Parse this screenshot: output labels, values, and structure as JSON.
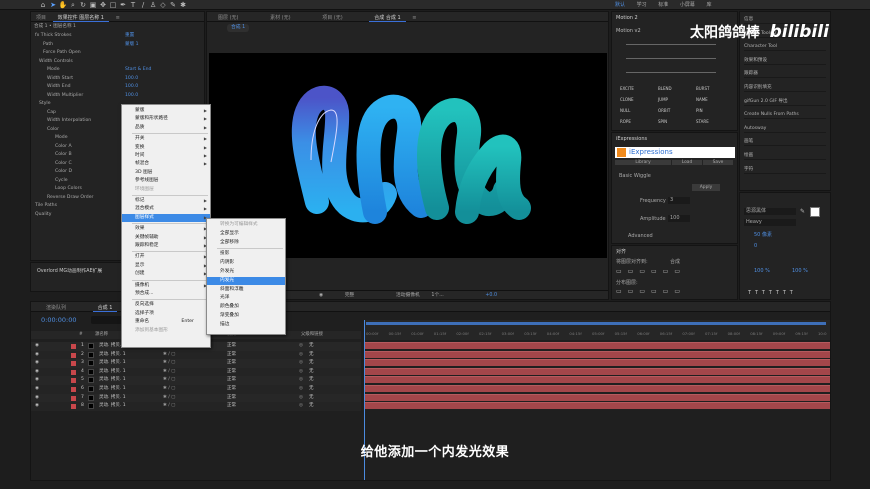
{
  "toolbar": {
    "workspace_tabs": [
      "默认",
      "学习",
      "标准",
      "小屏幕",
      "库"
    ]
  },
  "watermark": {
    "channel": "太阳鸽鸽棒",
    "site": "bilibili"
  },
  "effect_controls": {
    "tabs": [
      "项目",
      "效果控件 图层名称 1",
      "≡"
    ],
    "header": "合成 1 • 图层名称 1",
    "rows": [
      {
        "label": "fx  Thick Strokes",
        "value": "重置"
      },
      {
        "label": "Path",
        "value": "蒙版 1"
      },
      {
        "label": "Force Path Open",
        "value": ""
      },
      {
        "label": "Width Controls",
        "value": ""
      },
      {
        "label": "Mode",
        "value": "Start & End"
      },
      {
        "label": "Width Start",
        "value": "100.0"
      },
      {
        "label": "Width End",
        "value": "100.0"
      },
      {
        "label": "Width Multiplier",
        "value": "100.0"
      },
      {
        "label": "Style",
        "value": ""
      },
      {
        "label": "Cap",
        "value": ""
      },
      {
        "label": "Width Interpolation",
        "value": ""
      },
      {
        "label": "Color",
        "value": ""
      },
      {
        "label": "Mode",
        "value": ""
      },
      {
        "label": "Color A",
        "value": ""
      },
      {
        "label": "Color B",
        "value": ""
      },
      {
        "label": "Color C",
        "value": ""
      },
      {
        "label": "Color D",
        "value": ""
      },
      {
        "label": "Cycle",
        "value": ""
      },
      {
        "label": "Loop Colors",
        "value": ""
      },
      {
        "label": "Reverse Draw Order",
        "value": ""
      },
      {
        "label": "Tile Paths",
        "value": ""
      },
      {
        "label": "Quality",
        "value": ""
      }
    ]
  },
  "overlord_panel": {
    "title": "Overlord MG动画制作AE扩展"
  },
  "context_menu": {
    "items": [
      {
        "label": "蒙版",
        "sub": true,
        "disabled": false
      },
      {
        "label": "蒙版和形状路径",
        "sub": true,
        "disabled": false
      },
      {
        "label": "品质",
        "sub": true,
        "disabled": false
      },
      {
        "label": "开关",
        "sub": true,
        "disabled": false
      },
      {
        "label": "变换",
        "sub": true,
        "disabled": false
      },
      {
        "label": "时间",
        "sub": true,
        "disabled": false
      },
      {
        "label": "帧混合",
        "sub": true,
        "disabled": false
      },
      {
        "label": "3D 图层",
        "sub": false,
        "disabled": false
      },
      {
        "label": "参考线图层",
        "sub": false,
        "disabled": false
      },
      {
        "label": "环境图层",
        "sub": false,
        "disabled": true
      },
      {
        "label": "标记",
        "sub": true,
        "disabled": false
      },
      {
        "label": "混合模式",
        "sub": true,
        "disabled": false
      },
      {
        "label": "图层样式",
        "sub": true,
        "disabled": false,
        "highlight": true
      },
      {
        "label": "效果",
        "sub": true,
        "disabled": false
      },
      {
        "label": "关键帧辅助",
        "sub": true,
        "disabled": false
      },
      {
        "label": "跟踪和稳定",
        "sub": true,
        "disabled": false
      },
      {
        "label": "打开",
        "sub": true,
        "disabled": false
      },
      {
        "label": "显示",
        "sub": true,
        "disabled": false
      },
      {
        "label": "创建",
        "sub": true,
        "disabled": false
      },
      {
        "label": "摄像机",
        "sub": true,
        "disabled": false
      },
      {
        "label": "预合成...",
        "sub": false,
        "disabled": false
      },
      {
        "label": "反向选择",
        "sub": false,
        "disabled": false
      },
      {
        "label": "选择子项",
        "sub": false,
        "disabled": false
      },
      {
        "label": "重命名",
        "sub": false,
        "disabled": false,
        "shortcut": "Enter"
      },
      {
        "label": "添加到基本图形",
        "sub": false,
        "disabled": true
      }
    ]
  },
  "submenu": {
    "items": [
      {
        "label": "转换为可编辑样式",
        "disabled": true
      },
      {
        "label": "全部显示",
        "disabled": false
      },
      {
        "label": "全部移除",
        "disabled": false
      },
      {
        "label": "投影",
        "disabled": false
      },
      {
        "label": "内阴影",
        "disabled": false
      },
      {
        "label": "外发光",
        "disabled": false
      },
      {
        "label": "内发光",
        "disabled": false,
        "highlight": true
      },
      {
        "label": "斜面和浮雕",
        "disabled": false
      },
      {
        "label": "光泽",
        "disabled": false
      },
      {
        "label": "颜色叠加",
        "disabled": false
      },
      {
        "label": "渐变叠加",
        "disabled": false
      },
      {
        "label": "描边",
        "disabled": false
      }
    ]
  },
  "composition": {
    "tabs": [
      "图层 (无)",
      "素材 (无)",
      "项目 (无)",
      "合成 合成 1",
      "≡"
    ],
    "breadcrumb": "合成 1",
    "viewer_controls": [
      "完整",
      "活动摄像机",
      "1个...",
      "+0.0"
    ]
  },
  "right_panels": {
    "motion": {
      "title": "Motion 2",
      "subtitle": "Motion v2",
      "buttons": [
        "EXCITE",
        "BLEND",
        "BURST",
        "CLONE",
        "JUMP",
        "NAME",
        "NULL",
        "ORBIT",
        "PIN",
        "ROPE",
        "SPIN",
        "STARE"
      ]
    },
    "info_list": [
      "信息",
      "Motion Tools 2",
      "Character Tool",
      "效果和预设",
      "跟踪器",
      "内容识别填充",
      "gifGun 2.0 GIF 导出",
      "Create Nulls From Paths",
      "Autosway",
      "画笔",
      "绘画",
      "字符"
    ],
    "iexpressions": {
      "title": "iExpressions",
      "tabs": [
        "Library",
        "Load",
        "Save"
      ],
      "preset": "Basic Wiggle",
      "apply": "Apply",
      "param1_label": "Frequency",
      "param1_value": "3",
      "param2_label": "Amplitude",
      "param2_value": "100",
      "advanced": "Advanced"
    },
    "align": {
      "title": "对齐",
      "align_to_label": "将图层对齐到:",
      "align_to_value": "合成",
      "distribute": "分布图层:"
    },
    "character": {
      "font": "思源黑体",
      "style": "Heavy",
      "size": "50 像素",
      "tracking": "0",
      "scale_v": "100 %",
      "scale_h": "100 %"
    }
  },
  "timeline": {
    "tabs": [
      "渲染队列",
      "合成 1",
      "≡"
    ],
    "timecode": "0:00:00:00",
    "columns": [
      "#",
      "源名称",
      "模式",
      "T",
      "TrkMat",
      "父级和链接"
    ],
    "ruler": [
      "00:00f",
      "00:15f",
      "01:00f",
      "01:15f",
      "02:00f",
      "02:15f",
      "03:00f",
      "03:15f",
      "04:00f",
      "04:15f",
      "05:00f",
      "05:15f",
      "06:00f",
      "06:15f",
      "07:00f",
      "07:15f",
      "08:00f",
      "08:15f",
      "09:00f",
      "09:15f",
      "10:0"
    ],
    "layers": [
      {
        "num": "1",
        "name": "灵动. 拷贝. 1",
        "mode": "正常",
        "parent": "无"
      },
      {
        "num": "2",
        "name": "灵动. 拷贝. 1",
        "mode": "正常",
        "parent": "无"
      },
      {
        "num": "3",
        "name": "灵动. 拷贝. 1",
        "mode": "正常",
        "parent": "无"
      },
      {
        "num": "4",
        "name": "灵动. 拷贝. 1",
        "mode": "正常",
        "parent": "无"
      },
      {
        "num": "5",
        "name": "灵动. 拷贝. 1",
        "mode": "正常",
        "parent": "无"
      },
      {
        "num": "6",
        "name": "灵动. 拷贝. 1",
        "mode": "正常",
        "parent": "无"
      },
      {
        "num": "7",
        "name": "灵动. 拷贝. 1",
        "mode": "正常",
        "parent": "无"
      },
      {
        "num": "8",
        "name": "灵动. 拷贝. 1",
        "mode": "正常",
        "parent": "无"
      }
    ]
  },
  "subtitle": "给他添加一个内发光效果",
  "colors": {
    "accent": "#3c8ae6",
    "layer_bar": "#a3464a",
    "label_red": "#c8474b",
    "stroke_blue": "#2e8fe0",
    "stroke_teal": "#1fb8b0"
  }
}
